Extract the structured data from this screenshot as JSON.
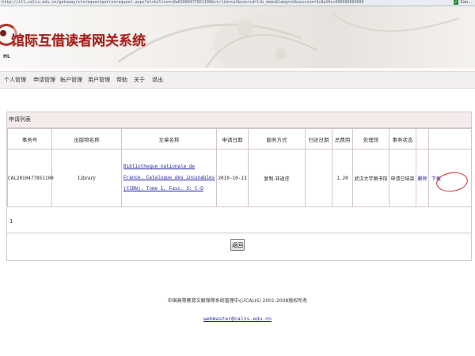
{
  "browser": {
    "url": "http://ill.calis.edu.cn/gateway/ctsrequestpatronrequest.aspx?strbillno=c0a02000477851100&strlib=cal&userid=lib_demo&lang=ch&session=3c8a10cc000000000000",
    "status_right": "Con..."
  },
  "header": {
    "site_title": "馆际互借读者网关系统",
    "logo_text": "HL"
  },
  "menu": {
    "items": [
      "个人管理",
      "申请管理",
      "帐户管理",
      "用户管理",
      "帮助",
      "关于",
      "退出"
    ]
  },
  "panel": {
    "title": "申请列表",
    "columns": [
      "事务号",
      "出版物名称",
      "文章名称",
      "申请日期",
      "服务方式",
      "归还日期",
      "总费用",
      "处理馆",
      "事务状态",
      "",
      ""
    ],
    "rows": [
      {
        "txn_id": "CAL2010477851100",
        "publication": "Library",
        "article": "Bibliotheque nationale de France. Catalogue des incunables (CIBN). Tome 1, Fasc. 3: C-D",
        "request_date": "2010-10-13",
        "service": "复制-非返还",
        "return_date": "",
        "fee": "1.20",
        "library": "武汉大学图书馆",
        "status": "申请已结束",
        "action_delete": "删除",
        "action_download": "下载"
      }
    ],
    "count": "1"
  },
  "back_button": "返回",
  "footer": {
    "text": "中国高等教育文献保障系统管理中心(CALIS) 2001-2008版权所有",
    "email": "webmaster@calis.edu.cn"
  },
  "colors": {
    "brand_red": "#a1201b",
    "menu_bg": "#f2efef",
    "panel_head_bg": "#f3ecec",
    "link_blue": "#1b1ba0",
    "annotation_red": "#d62828"
  }
}
